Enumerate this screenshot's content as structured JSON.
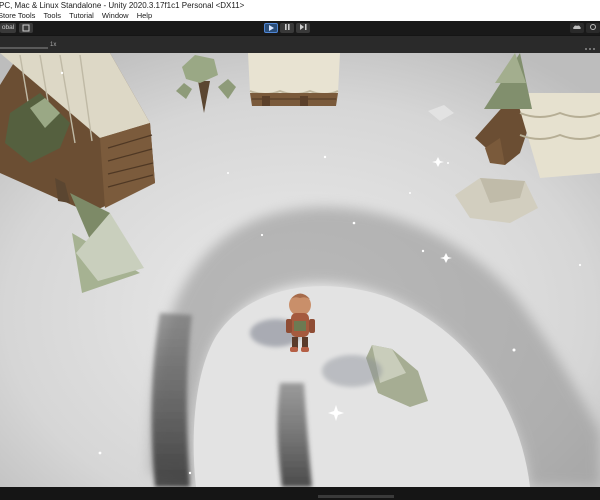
{
  "window": {
    "title": "PC, Mac & Linux Standalone - Unity 2020.3.17f1c1 Personal <DX11>"
  },
  "menu": {
    "items": [
      "Store Tools",
      "Tools",
      "Tutorial",
      "Window",
      "Help"
    ]
  },
  "toolbar": {
    "left_button_label": "obal",
    "play_icon": "play-icon",
    "pause_icon": "pause-icon",
    "step_icon": "step-icon"
  },
  "game_view": {
    "scale_label": "1x"
  },
  "colors": {
    "snow": "#d9d9d9",
    "pine": "#7c8569",
    "cabin_roof": "#e6e1cf",
    "cabin_wall": "#7a5a3b",
    "player_hair": "#c98f6a"
  }
}
